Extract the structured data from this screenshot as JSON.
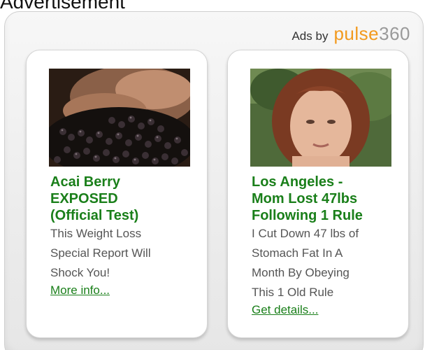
{
  "header": {
    "label": "Advertisement"
  },
  "panel": {
    "ads_by": "Ads by",
    "brand_pulse": "pulse",
    "brand_num": "360"
  },
  "ads": [
    {
      "headline_lines": [
        "Acai Berry",
        "EXPOSED",
        "(Official Test)"
      ],
      "description_lines": [
        "This Weight Loss",
        "Special Report Will",
        "Shock You!"
      ],
      "link_text": "More info... ",
      "image_icon": "acai-berries-image"
    },
    {
      "headline_lines": [
        "Los Angeles -",
        "Mom Lost 47lbs",
        "Following 1 Rule"
      ],
      "description_lines": [
        "I Cut Down 47 lbs of",
        "Stomach Fat In A",
        "Month By Obeying",
        "This 1 Old Rule"
      ],
      "link_text": "Get details... ",
      "image_icon": "woman-portrait-image"
    }
  ],
  "colors": {
    "headline_green": "#1a7f1a",
    "brand_orange": "#f29a1e",
    "brand_gray": "#9a9a9a",
    "description_gray": "#555555"
  }
}
